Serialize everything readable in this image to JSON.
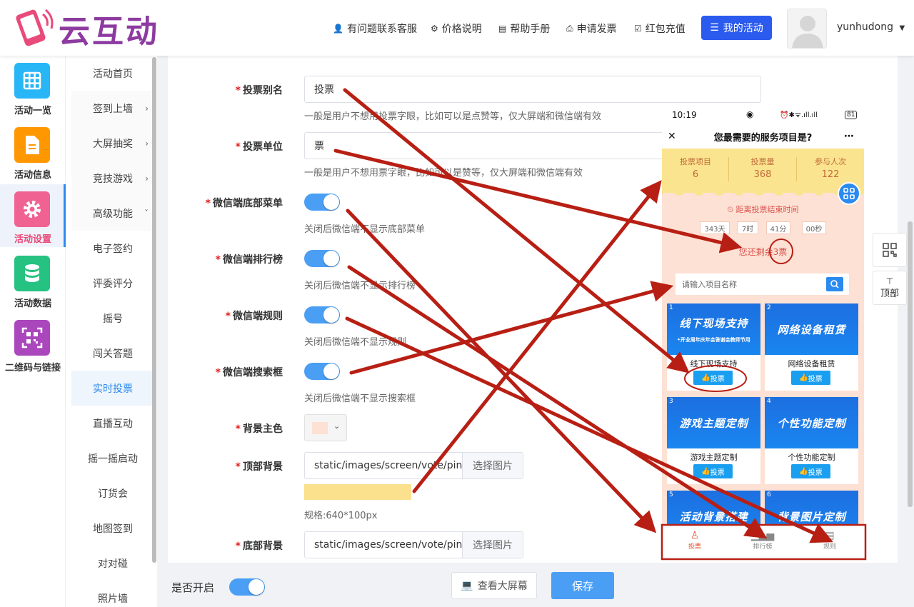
{
  "header": {
    "logo_text": "云互动",
    "nav": [
      {
        "label": "有问题联系客服",
        "icon": "user-add-icon"
      },
      {
        "label": "价格说明",
        "icon": "gear-icon"
      },
      {
        "label": "帮助手册",
        "icon": "book-icon"
      },
      {
        "label": "申请发票",
        "icon": "printer-icon"
      },
      {
        "label": "红包充值",
        "icon": "check-shield-icon"
      }
    ],
    "my_activity_label": "我的活动",
    "username": "yunhudong"
  },
  "sidebar": {
    "items": [
      {
        "label": "活动一览",
        "color": "#29b6f6",
        "icon": "grid-icon"
      },
      {
        "label": "活动信息",
        "color": "#ff9800",
        "icon": "document-icon"
      },
      {
        "label": "活动设置",
        "color": "#f06292",
        "icon": "gear-icon",
        "active": true
      },
      {
        "label": "活动数据",
        "color": "#26c281",
        "icon": "database-icon"
      },
      {
        "label": "二维码与链接",
        "color": "#ab47bc",
        "icon": "qrcode-icon"
      }
    ]
  },
  "submenu": {
    "items": [
      {
        "label": "活动首页"
      },
      {
        "label": "签到上墙",
        "chevron": "›"
      },
      {
        "label": "大屏抽奖",
        "chevron": "›"
      },
      {
        "label": "竞技游戏",
        "chevron": "›"
      },
      {
        "label": "高级功能",
        "chevron": "ˇ"
      },
      {
        "label": "电子签约"
      },
      {
        "label": "评委评分"
      },
      {
        "label": "摇号"
      },
      {
        "label": "闯关答题"
      },
      {
        "label": "实时投票",
        "active": true
      },
      {
        "label": "直播互动"
      },
      {
        "label": "摇一摇启动"
      },
      {
        "label": "订货会"
      },
      {
        "label": "地图签到"
      },
      {
        "label": "对对碰"
      },
      {
        "label": "照片墙"
      }
    ]
  },
  "form": {
    "vote_alias": {
      "label": "投票别名",
      "value": "投票",
      "hint": "一般是用户不想用投票字眼，比如可以是点赞等，仅大屏端和微信端有效"
    },
    "vote_unit": {
      "label": "投票单位",
      "value": "票",
      "hint": "一般是用户不想用票字眼，比如可以是赞等，仅大屏端和微信端有效"
    },
    "bottom_menu": {
      "label": "微信端底部菜单",
      "hint": "关闭后微信端不显示底部菜单",
      "on": true
    },
    "ranking": {
      "label": "微信端排行榜",
      "hint": "关闭后微信端不显示排行榜",
      "on": true
    },
    "rules": {
      "label": "微信端规则",
      "hint": "关闭后微信端不显示规则",
      "on": true
    },
    "search_box": {
      "label": "微信端搜索框",
      "hint": "关闭后微信端不显示搜索框",
      "on": true
    },
    "bg_color": {
      "label": "背景主色",
      "value": "#fde1d4"
    },
    "top_bg": {
      "label": "顶部背景",
      "path": "static/images/screen/vote/pink/",
      "button": "选择图片",
      "spec": "规格:640*100px",
      "preview_color": "#fbe08e"
    },
    "bottom_bg": {
      "label": "底部背景",
      "path": "static/images/screen/vote/pink/",
      "button": "选择图片"
    },
    "required_mark": "*"
  },
  "bottom_bar": {
    "enable_label": "是否开启",
    "enable_on": true,
    "view_screen_label": "查看大屏幕",
    "save_label": "保存"
  },
  "float": {
    "top_label": "顶部"
  },
  "phone": {
    "time": "10:19",
    "battery": "81",
    "title": "您最需要的服务项目是?",
    "stats": [
      {
        "label": "投票项目",
        "value": "6"
      },
      {
        "label": "投票量",
        "value": "368"
      },
      {
        "label": "参与人次",
        "value": "122"
      }
    ],
    "countdown_title": "距离投票结束时间",
    "countdown": [
      "343天",
      "7时",
      "41分",
      "00秒"
    ],
    "remaining": "您还剩余3票",
    "search_placeholder": "请输入项目名称",
    "cards": [
      {
        "num": "1",
        "title": "线下现场支持",
        "subtitle": "•开业周年庆年会答谢会教师节用",
        "name": "线下现场支持",
        "button": "投票"
      },
      {
        "num": "2",
        "title": "网络设备租赁",
        "name": "网络设备租赁",
        "button": "投票"
      },
      {
        "num": "3",
        "title": "游戏主题定制",
        "name": "游戏主题定制",
        "button": "投票"
      },
      {
        "num": "4",
        "title": "个性功能定制",
        "name": "个性功能定制",
        "button": "投票"
      },
      {
        "num": "5",
        "title": "活动背景搭建",
        "name": "",
        "button": ""
      },
      {
        "num": "6",
        "title": "背景图片定制",
        "name": "",
        "button": ""
      }
    ],
    "tabs": [
      {
        "label": "投票",
        "icon": "user-icon"
      },
      {
        "label": "排行榜",
        "icon": "bar-chart-icon"
      },
      {
        "label": "规则",
        "icon": "rules-icon"
      }
    ]
  },
  "colors": {
    "primary": "#2b5bee",
    "toggle": "#4a9ff5",
    "annotation": "#b81f14",
    "phone_bg": "#fde1d4"
  }
}
